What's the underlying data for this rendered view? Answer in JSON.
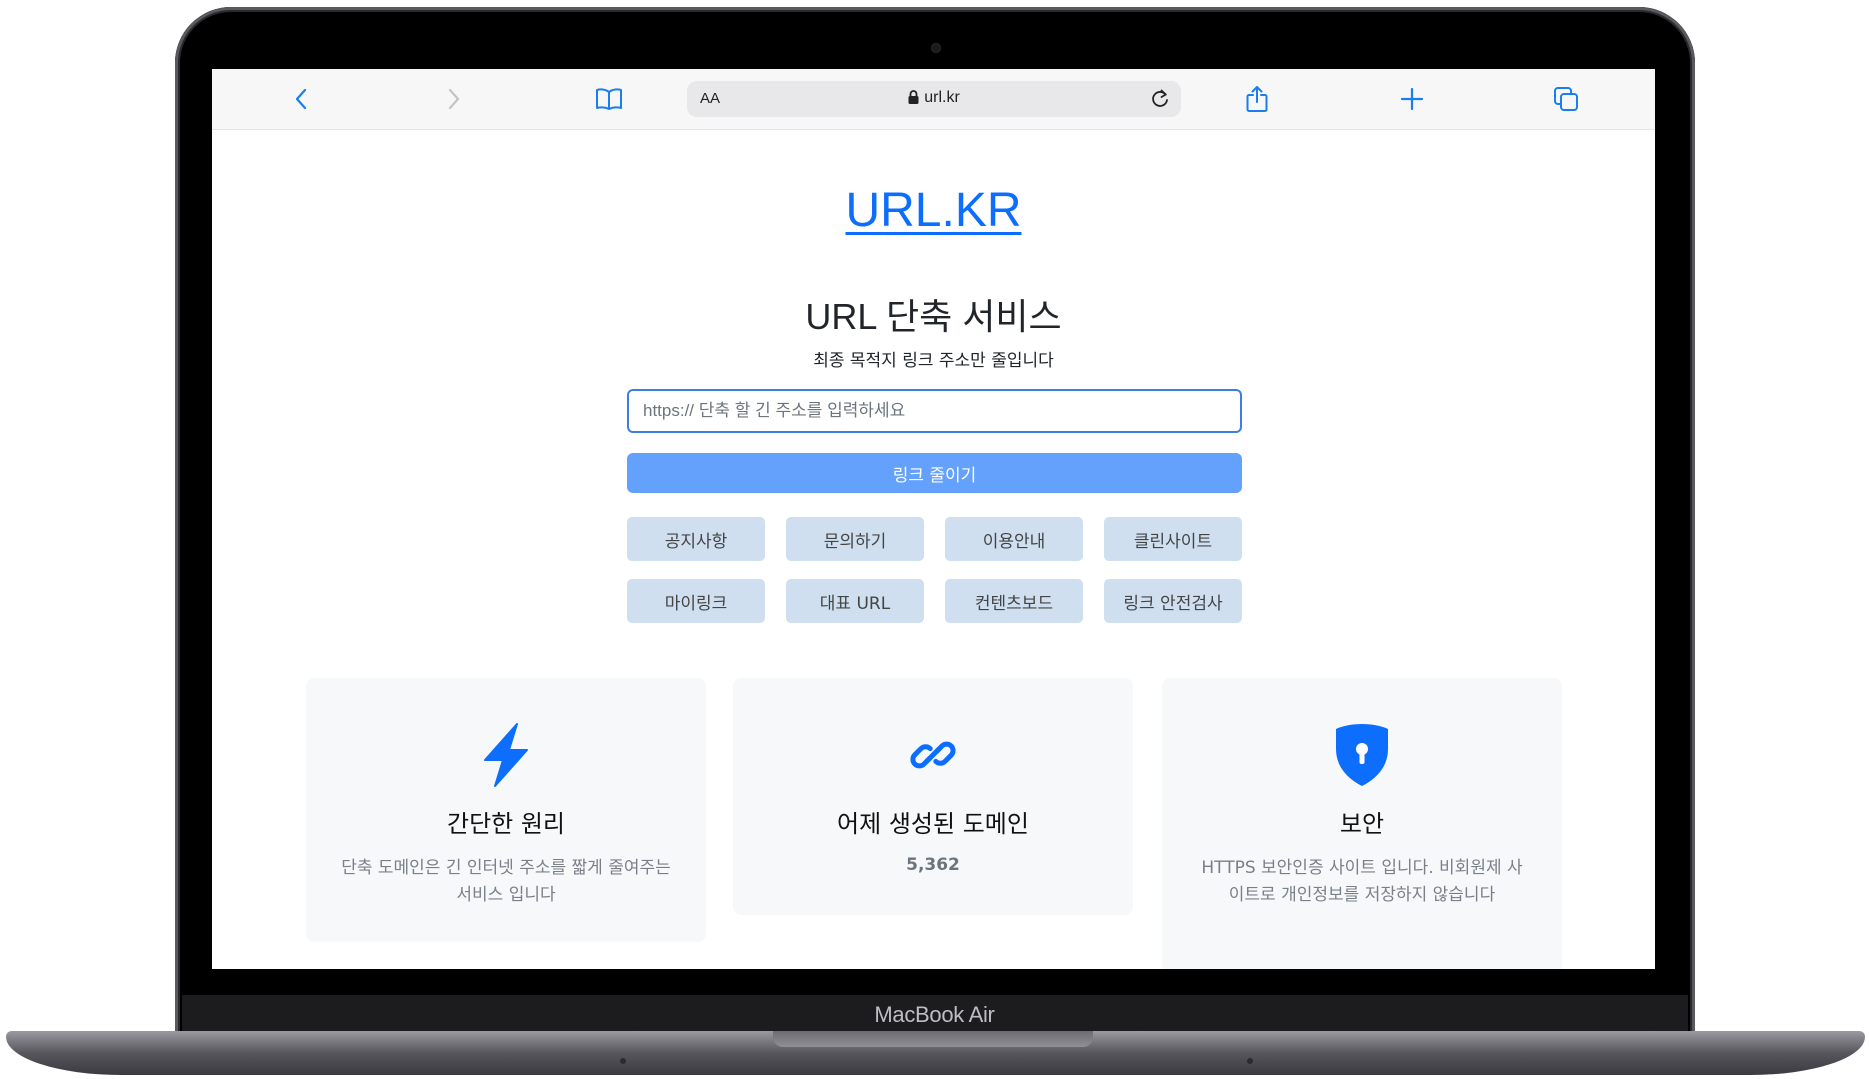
{
  "device": {
    "brand_label": "MacBook Air"
  },
  "browser": {
    "text_size_label": "AA",
    "address": "url.kr",
    "icons": [
      "back-icon",
      "forward-icon",
      "bookmarks-icon",
      "lock-icon",
      "reload-icon",
      "share-icon",
      "new-tab-icon",
      "tabs-icon"
    ]
  },
  "page": {
    "logo": "URL.KR",
    "heading": "URL 단축 서비스",
    "subheading": "최종 목적지 링크 주소만 줄입니다",
    "url_input": {
      "placeholder": "https:// 단축 할 긴 주소를 입력하세요",
      "value": ""
    },
    "shorten_button": "링크 줄이기",
    "quick_links": [
      {
        "label": "공지사항"
      },
      {
        "label": "문의하기"
      },
      {
        "label": "이용안내"
      },
      {
        "label": "클린사이트"
      },
      {
        "label": "마이링크"
      },
      {
        "label": "대표 URL"
      },
      {
        "label": "컨텐츠보드"
      },
      {
        "label": "링크 안전검사"
      }
    ],
    "features": [
      {
        "icon": "lightning-icon",
        "title": "간단한 원리",
        "description": "단축 도메인은 긴 인터넷 주소를 짧게 줄여주는 서비스 입니다"
      },
      {
        "icon": "link-icon",
        "title": "어제 생성된 도메인",
        "value": "5,362"
      },
      {
        "icon": "shield-lock-icon",
        "title": "보안",
        "description": "HTTPS 보안인증 사이트 입니다. 비회원제 사이트로 개인정보를 저장하지 않습니다"
      }
    ]
  },
  "colors": {
    "accent": "#0d6efd",
    "button": "#63a1fd",
    "quick_link_bg": "#cfdff0",
    "card_bg": "#f7f8fa"
  }
}
